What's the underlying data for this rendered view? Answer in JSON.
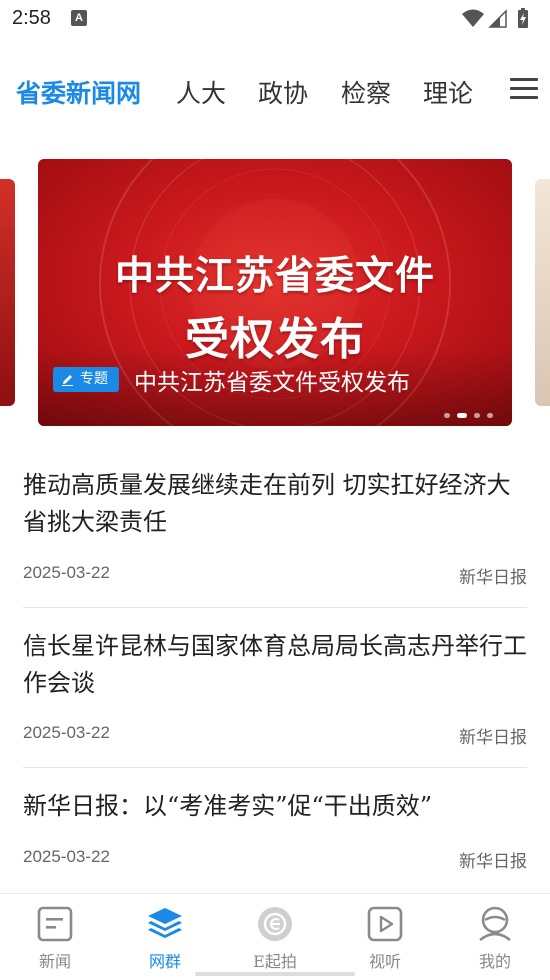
{
  "status_bar": {
    "time": "2:58",
    "notification_icon": "A"
  },
  "top_nav": {
    "tabs": [
      {
        "label": "省委新闻网",
        "active": true
      },
      {
        "label": "人大",
        "active": false
      },
      {
        "label": "政协",
        "active": false
      },
      {
        "label": "检察",
        "active": false
      },
      {
        "label": "理论",
        "active": false
      }
    ],
    "menu_icon": "hamburger-menu-icon"
  },
  "carousel": {
    "banner_title_line1": "中共江苏省委文件",
    "banner_title_line2": "受权发布",
    "badge_label": "专题",
    "caption": "中共江苏省委文件受权发布",
    "slide_count": 4,
    "active_slide": 2
  },
  "news": [
    {
      "title": "推动高质量发展继续走在前列 切实扛好经济大省挑大梁责任",
      "date": "2025-03-22",
      "source": "新华日报"
    },
    {
      "title": "信长星许昆林与国家体育总局局长高志丹举行工作会谈",
      "date": "2025-03-22",
      "source": "新华日报"
    },
    {
      "title": "新华日报：以“考准考实”促“干出质效”",
      "date": "2025-03-22",
      "source": "新华日报"
    }
  ],
  "bottom_nav": [
    {
      "label": "新闻",
      "icon": "news-doc-icon",
      "active": false
    },
    {
      "label": "网群",
      "icon": "layers-icon",
      "active": true
    },
    {
      "label": "E起拍",
      "icon": "e-camera-icon",
      "active": false
    },
    {
      "label": "视听",
      "icon": "play-icon",
      "active": false
    },
    {
      "label": "我的",
      "icon": "profile-icon",
      "active": false
    }
  ],
  "colors": {
    "accent": "#1b8ae6",
    "banner_red": "#c9181d"
  }
}
